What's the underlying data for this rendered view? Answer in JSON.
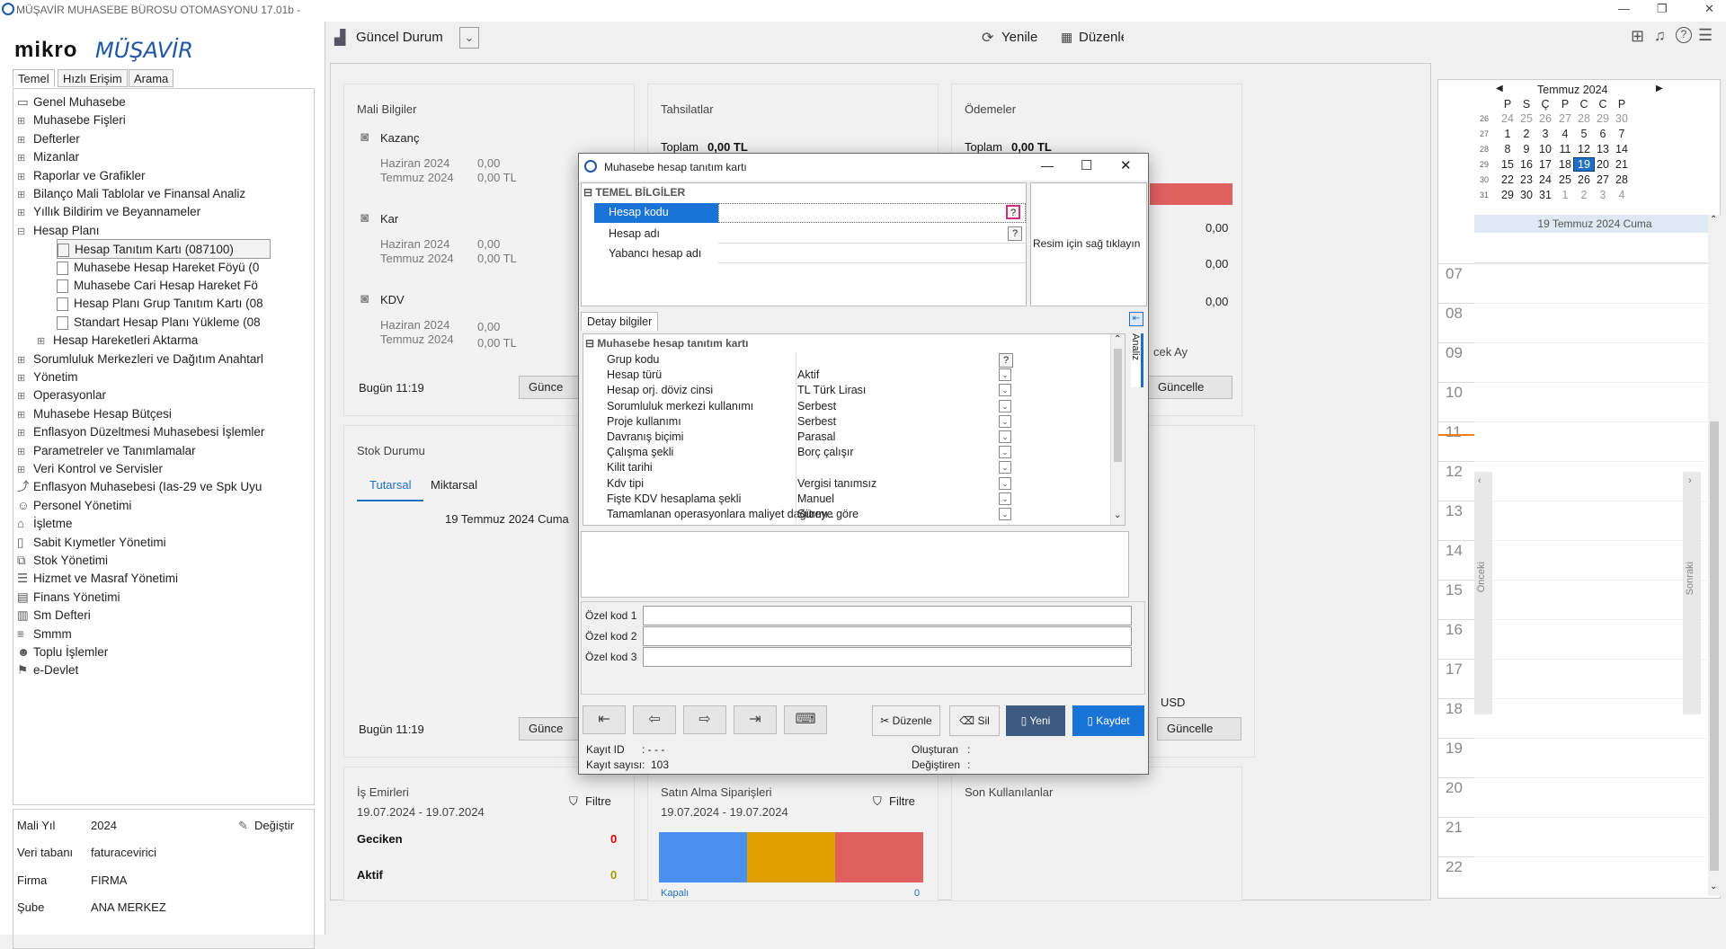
{
  "window": {
    "title": "MÜŞAVİR MUHASEBE BÜROSU OTOMASYONU 17.01b -"
  },
  "brand": {
    "logo_text": "mikro",
    "logo_script": "MÜŞAVİR"
  },
  "left_tabs": [
    "Temel",
    "Hızlı Erişim",
    "Arama"
  ],
  "tree": [
    {
      "label": "Genel Muhasebe",
      "level": 0,
      "expander": "",
      "icon": "folder-open"
    },
    {
      "label": "Muhasebe Fişleri",
      "level": 1,
      "expander": "⊞"
    },
    {
      "label": "Defterler",
      "level": 1,
      "expander": "⊞"
    },
    {
      "label": "Mizanlar",
      "level": 1,
      "expander": "⊞"
    },
    {
      "label": "Raporlar ve Grafikler",
      "level": 1,
      "expander": "⊞"
    },
    {
      "label": "Bilanço Mali Tablolar ve Finansal Analiz",
      "level": 1,
      "expander": "⊞"
    },
    {
      "label": "Yıllık Bildirim ve Beyannameler",
      "level": 1,
      "expander": "⊞"
    },
    {
      "label": "Hesap Planı",
      "level": 1,
      "expander": "⊟"
    },
    {
      "label": "Hesap Tanıtım Kartı (087100)",
      "level": 2,
      "selected": true
    },
    {
      "label": "Muhasebe Hesap Hareket Föyü (0",
      "level": 2
    },
    {
      "label": "Muhasebe Cari Hesap Hareket Fö",
      "level": 2
    },
    {
      "label": "Hesap Planı Grup Tanıtım Kartı (08",
      "level": 2
    },
    {
      "label": "Standart Hesap Planı Yükleme (08",
      "level": 2
    },
    {
      "label": "Hesap Hareketleri Aktarma",
      "level": 1.5,
      "expander": "⊞"
    },
    {
      "label": "Sorumluluk Merkezleri ve Dağıtım Anahtarl",
      "level": 1,
      "expander": "⊞"
    },
    {
      "label": "Yönetim",
      "level": 1,
      "expander": "⊞"
    },
    {
      "label": "Operasyonlar",
      "level": 1,
      "expander": "⊞"
    },
    {
      "label": "Muhasebe Hesap Bütçesi",
      "level": 1,
      "expander": "⊞"
    },
    {
      "label": "Enflasyon Düzeltmesi Muhasebesi İşlemler",
      "level": 1,
      "expander": "⊞"
    },
    {
      "label": "Parametreler ve Tanımlamalar",
      "level": 1,
      "expander": "⊞"
    },
    {
      "label": "Veri Kontrol ve Servisler",
      "level": 1,
      "expander": "⊞"
    },
    {
      "label": "Enflasyon Muhasebesi (Ias-29 ve Spk Uyu",
      "level": 0,
      "icon": "chart"
    },
    {
      "label": "Personel Yönetimi",
      "level": 0,
      "icon": "people"
    },
    {
      "label": "İşletme",
      "level": 0,
      "icon": "building"
    },
    {
      "label": "Sabit Kıymetler Yönetimi",
      "level": 0,
      "icon": "doc"
    },
    {
      "label": "Stok Yönetimi",
      "level": 0,
      "icon": "box"
    },
    {
      "label": "Hizmet ve Masraf Yönetimi",
      "level": 0,
      "icon": "list"
    },
    {
      "label": "Finans Yönetimi",
      "level": 0,
      "icon": "calc"
    },
    {
      "label": "Sm Defteri",
      "level": 0,
      "icon": "book"
    },
    {
      "label": "Smmm",
      "level": 0,
      "icon": "stack"
    },
    {
      "label": "Toplu İşlemler",
      "level": 0,
      "icon": "user"
    },
    {
      "label": "e-Devlet",
      "level": 0,
      "icon": "gov"
    }
  ],
  "info": {
    "mali_yil_label": "Mali Yıl",
    "mali_yil": "2024",
    "degistir": "Değiştir",
    "veritabani_label": "Veri tabanı",
    "veritabani": "faturacevirici",
    "firma_label": "Firma",
    "firma": "FIRMA",
    "sube_label": "Şube",
    "sube": "ANA MERKEZ"
  },
  "topbar": {
    "guncel_durum": "Güncel Durum",
    "yenile": "Yenile",
    "duzenle": "Düzenle"
  },
  "dashboard": {
    "mali": {
      "title": "Mali Bilgiler",
      "items": [
        {
          "name": "Kazanç",
          "rows": [
            [
              "Haziran 2024",
              "0,00"
            ],
            [
              "Temmuz 2024",
              "0,00 TL"
            ]
          ]
        },
        {
          "name": "Kar",
          "rows": [
            [
              "Haziran 2024",
              "0,00"
            ],
            [
              "Temmuz 2024",
              "0,00 TL"
            ]
          ]
        },
        {
          "name": "KDV",
          "rows": [
            [
              "Haziran 2024",
              "0,00"
            ],
            [
              "Temmuz 2024",
              "0,00 TL"
            ]
          ]
        }
      ],
      "bugun": "Bugün 11:19",
      "guncelle": "Günce"
    },
    "tahsilatlar": {
      "title": "Tahsilatlar",
      "toplam_label": "Toplam",
      "toplam": "0,00 TL"
    },
    "odemeler": {
      "title": "Ödemeler",
      "toplam_label": "Toplam",
      "toplam": "0,00 TL",
      "values": [
        "0,00",
        "0,00",
        "0,00"
      ],
      "gelecek_ay": "cek Ay",
      "guncelle": "Güncelle"
    },
    "stok": {
      "title": "Stok Durumu",
      "tab1": "Tutarsal",
      "tab2": "Miktarsal",
      "date": "19 Temmuz 2024 Cuma",
      "bugun": "Bugün 11:19",
      "guncelle": "Günce",
      "guncelle2": "Güncelle",
      "usd": "USD"
    },
    "is_emirleri": {
      "title": "İş Emirleri",
      "range": "19.07.2024 - 19.07.2024",
      "filtre": "Filtre",
      "geciken": "Geciken",
      "geciken_val": "0",
      "aktif": "Aktif",
      "aktif_val": "0"
    },
    "satin_alma": {
      "title": "Satın Alma Siparişleri",
      "range": "19.07.2024 - 19.07.2024",
      "filtre": "Filtre",
      "kapali": "Kapalı",
      "kapali_val": "0",
      "bar_colors": [
        "#4a90f0",
        "#e0a000",
        "#e06060"
      ]
    },
    "son_kullanilanlar": {
      "title": "Son Kullanılanlar"
    }
  },
  "dialog": {
    "title": "Muhasebe hesap tanıtım kartı",
    "temel_header": "TEMEL BİLGİLER",
    "temel_rows": [
      "Hesap kodu",
      "Hesap adı",
      "Yabancı hesap adı"
    ],
    "resim": "Resim için sağ tıklayın",
    "detay_tab": "Detay bilgiler",
    "analiz_tab": "Analiz",
    "detay_header": "Muhasebe hesap tanıtım kartı",
    "detay_rows": [
      {
        "label": "Grup kodu",
        "value": "",
        "ctrl": "?"
      },
      {
        "label": "Hesap türü",
        "value": "Aktif",
        "ctrl": "v"
      },
      {
        "label": "Hesap orj. döviz cinsi",
        "value": "TL Türk Lirası",
        "ctrl": "v"
      },
      {
        "label": "Sorumluluk merkezi kullanımı",
        "value": "Serbest",
        "ctrl": "v"
      },
      {
        "label": "Proje kullanımı",
        "value": "Serbest",
        "ctrl": "v"
      },
      {
        "label": "Davranış biçimi",
        "value": "Parasal",
        "ctrl": "v"
      },
      {
        "label": "Çalışma şekli",
        "value": "Borç çalışır",
        "ctrl": "v"
      },
      {
        "label": "Kilit tarihi",
        "value": "",
        "ctrl": "v"
      },
      {
        "label": "Kdv tipi",
        "value": "Vergisi tanımsız",
        "ctrl": "v"
      },
      {
        "label": "Fişte KDV hesaplama şekli",
        "value": "Manuel",
        "ctrl": "v"
      },
      {
        "label": "Tamamlanan operasyonlara maliyet dağıtımı..",
        "value": "Süreye göre",
        "ctrl": "v"
      }
    ],
    "ozel": [
      "Özel kod 1",
      "Özel kod 2",
      "Özel kod 3"
    ],
    "buttons": {
      "duzenle": "Düzenle",
      "sil": "Sil",
      "yeni": "Yeni",
      "kaydet": "Kaydet"
    },
    "kayit_id_label": "Kayıt ID",
    "kayit_id": ": - - -",
    "kayit_sayisi_label": "Kayıt sayısı:",
    "kayit_sayisi": "103",
    "olusturan_label": "Oluşturan",
    "degistiren_label": "Değiştiren",
    "colon": ":"
  },
  "calendar": {
    "month": "Temmuz 2024",
    "dow": [
      "P",
      "S",
      "Ç",
      "P",
      "C",
      "C",
      "P"
    ],
    "weeks": [
      {
        "wk": "26",
        "days": [
          "24",
          "25",
          "26",
          "27",
          "28",
          "29",
          "30"
        ]
      },
      {
        "wk": "27",
        "days": [
          "1",
          "2",
          "3",
          "4",
          "5",
          "6",
          "7"
        ]
      },
      {
        "wk": "28",
        "days": [
          "8",
          "9",
          "10",
          "11",
          "12",
          "13",
          "14"
        ]
      },
      {
        "wk": "29",
        "days": [
          "15",
          "16",
          "17",
          "18",
          "19",
          "20",
          "21"
        ]
      },
      {
        "wk": "30",
        "days": [
          "22",
          "23",
          "24",
          "25",
          "26",
          "27",
          "28"
        ]
      },
      {
        "wk": "31",
        "days": [
          "29",
          "30",
          "31",
          "1",
          "2",
          "3",
          "4"
        ]
      }
    ],
    "day_header": "19 Temmuz 2024 Cuma",
    "hours": [
      "07",
      "08",
      "09",
      "10",
      "11",
      "12",
      "13",
      "14",
      "15",
      "16",
      "17",
      "18",
      "19",
      "20",
      "21",
      "22"
    ],
    "onceki": "Önceki",
    "sonraki": "Sonraki",
    "today_color": "#1f6fc5"
  }
}
